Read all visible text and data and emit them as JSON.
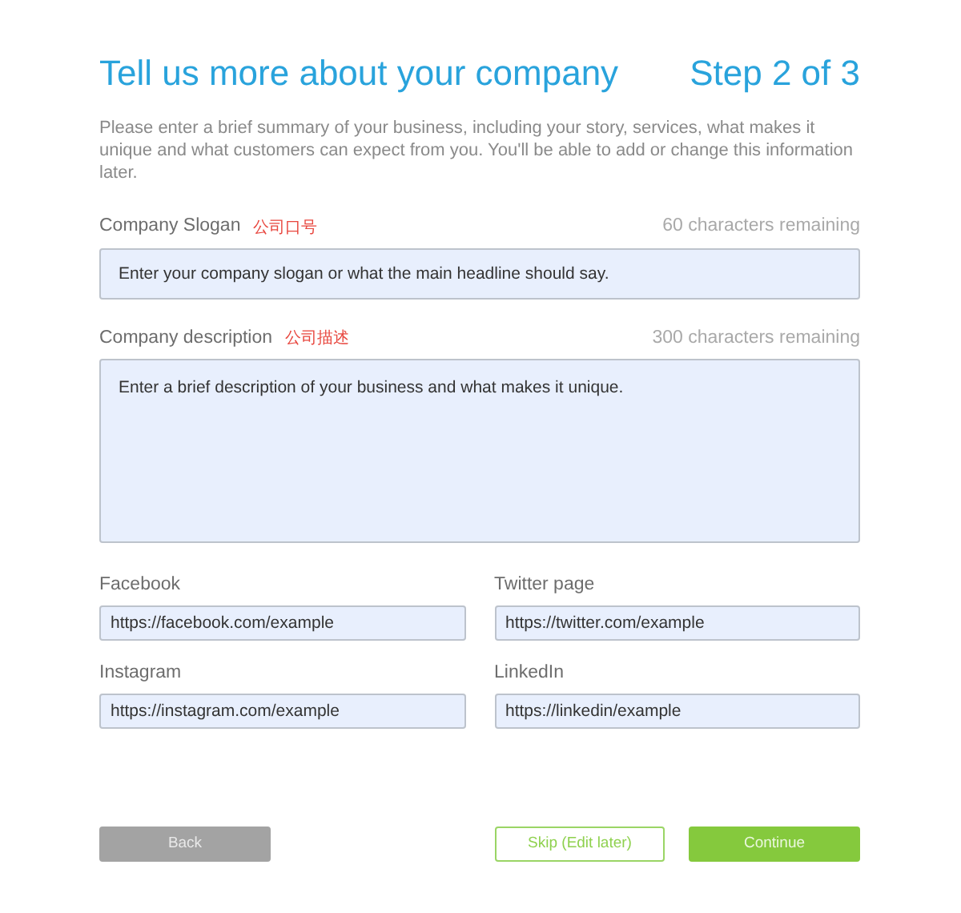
{
  "header": {
    "title": "Tell us more about your company",
    "step": "Step 2 of 3"
  },
  "intro": "Please enter a brief summary of your business, including your story, services, what makes it unique and what customers can expect from you. You'll be able to add or change this information later.",
  "main_fields": [
    {
      "kind": "input",
      "label": "Company Slogan",
      "note": "公司口号",
      "counter": "60 characters remaining",
      "placeholder": "Enter your company slogan or what the main headline should say."
    },
    {
      "kind": "textarea",
      "label": "Company description",
      "note": "公司描述",
      "counter": "300 characters remaining",
      "placeholder": "Enter a brief description of your business and what makes it unique."
    }
  ],
  "social_fields": [
    {
      "label": "Facebook",
      "placeholder": "https://facebook.com/example"
    },
    {
      "label": "Twitter page",
      "placeholder": "https://twitter.com/example"
    },
    {
      "label": "Instagram",
      "placeholder": "https://instagram.com/example"
    },
    {
      "label": "LinkedIn",
      "placeholder": "https://linkedin/example"
    }
  ],
  "buttons": [
    {
      "kind": "back",
      "label": "Back"
    },
    {
      "kind": "skip",
      "label": "Skip (Edit later)"
    },
    {
      "kind": "continue",
      "label": "Continue"
    }
  ]
}
